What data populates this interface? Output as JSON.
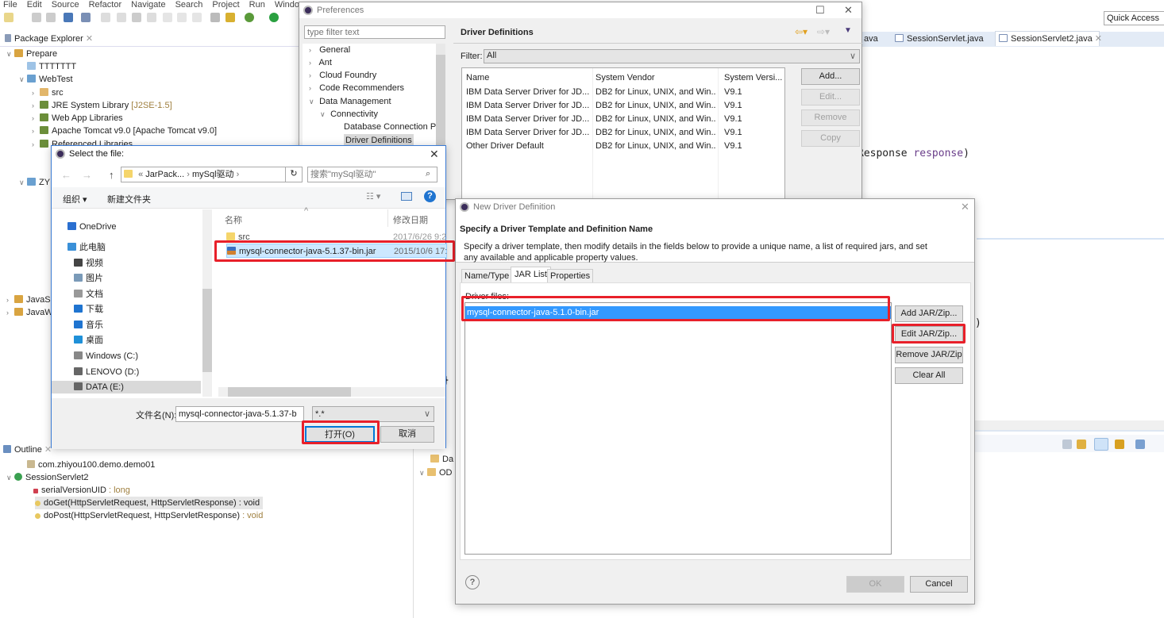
{
  "menubar": [
    "File",
    "Edit",
    "Source",
    "Refactor",
    "Navigate",
    "Search",
    "Project",
    "Run",
    "Window"
  ],
  "quick_access": "Quick Access",
  "package_explorer": {
    "title": "Package Explorer",
    "items": [
      {
        "label": "Prepare",
        "suffix": ""
      },
      {
        "label": "TTTTTTT",
        "suffix": ""
      },
      {
        "label": "WebTest",
        "suffix": ""
      },
      {
        "label": "src",
        "suffix": ""
      },
      {
        "label": "JRE System Library",
        "suffix": "[J2SE-1.5]"
      },
      {
        "label": "Web App Libraries",
        "suffix": ""
      },
      {
        "label": "Apache Tomcat v9.0 [Apache Tomcat v9.0]",
        "suffix": ""
      },
      {
        "label": "Referenced Libraries",
        "suffix": ""
      },
      {
        "label": "ZY",
        "suffix": ""
      },
      {
        "label": "JavaS",
        "suffix": ""
      },
      {
        "label": "JavaW",
        "suffix": ""
      }
    ]
  },
  "editor": {
    "tabs": [
      "ava",
      "SessionServlet.java",
      "SessionServlet2.java"
    ],
    "code": {
      "type_part": "Response",
      "param": "response",
      "paren": ")",
      "paren2": ")",
      "brace": "}"
    }
  },
  "outline": {
    "title": "Outline",
    "items": [
      {
        "label": "com.zhiyou100.demo.demo01",
        "type": ""
      },
      {
        "label": "SessionServlet2",
        "type": ""
      },
      {
        "label": "serialVersionUID",
        "type": " : long"
      },
      {
        "label": "doGet(HttpServletRequest, HttpServletResponse)",
        "type": " : void"
      },
      {
        "label": "doPost(HttpServletRequest, HttpServletResponse)",
        "type": " : void"
      }
    ]
  },
  "data_source_items": [
    "Da",
    "OD"
  ],
  "preferences": {
    "title": "Preferences",
    "filter_placeholder": "type filter text",
    "tree": [
      "General",
      "Ant",
      "Cloud Foundry",
      "Code Recommenders",
      "Data Management",
      "Connectivity",
      "Database Connection Pr",
      "Driver Definitions"
    ],
    "page_title": "Driver Definitions",
    "filter_label": "Filter:",
    "filter_value": "All",
    "columns": [
      "Name",
      "System Vendor",
      "System Versi..."
    ],
    "rows": [
      [
        "IBM Data Server Driver for JD...",
        "DB2 for Linux, UNIX, and Win...",
        "V9.1"
      ],
      [
        "IBM Data Server Driver for JD...",
        "DB2 for Linux, UNIX, and Win...",
        "V9.1"
      ],
      [
        "IBM Data Server Driver for JD...",
        "DB2 for Linux, UNIX, and Win...",
        "V9.1"
      ],
      [
        "IBM Data Server Driver for JD...",
        "DB2 for Linux, UNIX, and Win...",
        "V9.1"
      ],
      [
        "Other Driver Default",
        "DB2 for Linux, UNIX, and Win...",
        "V9.1"
      ]
    ],
    "buttons": {
      "add": "Add...",
      "edit": "Edit...",
      "remove": "Remove",
      "copy": "Copy"
    }
  },
  "file_dialog": {
    "title": "Select the file:",
    "breadcrumb": [
      "«",
      "JarPack...",
      "›",
      "mySql驱动",
      "›"
    ],
    "search_placeholder": "搜索\"mySql驱动\"",
    "organize": "组织 ▾",
    "new_folder": "新建文件夹",
    "nav": [
      "OneDrive",
      "此电脑",
      "视频",
      "图片",
      "文档",
      "下载",
      "音乐",
      "桌面",
      "Windows (C:)",
      "LENOVO (D:)",
      "DATA (E:)"
    ],
    "col_name": "名称",
    "col_date": "修改日期",
    "files": [
      {
        "name": "src",
        "date": "2017/6/26 9:2"
      },
      {
        "name": "mysql-connector-java-5.1.37-bin.jar",
        "date": "2015/10/6 17:"
      }
    ],
    "filename_label": "文件名(N):",
    "filename_value": "mysql-connector-java-5.1.37-b",
    "filetype": "*.*",
    "open": "打开(O)",
    "cancel": "取消"
  },
  "new_driver": {
    "title": "New Driver Definition",
    "header": "Specify a Driver Template and Definition Name",
    "description": "Specify a driver template, then modify details in the fields below to provide a unique name, a list of required jars, and set any available and applicable property values.",
    "tabs": [
      "Name/Type",
      "JAR List",
      "Properties"
    ],
    "active_tab": "JAR List",
    "driver_files_label": "Driver files:",
    "files": [
      "mysql-connector-java-5.1.0-bin.jar"
    ],
    "buttons": {
      "add": "Add JAR/Zip...",
      "edit": "Edit JAR/Zip...",
      "remove": "Remove JAR/Zip",
      "clear": "Clear All"
    },
    "ok": "OK",
    "cancel": "Cancel"
  },
  "colors": {
    "highlight": "#e8202a",
    "selection": "#3399ff",
    "file_selection": "#cce8ff"
  }
}
